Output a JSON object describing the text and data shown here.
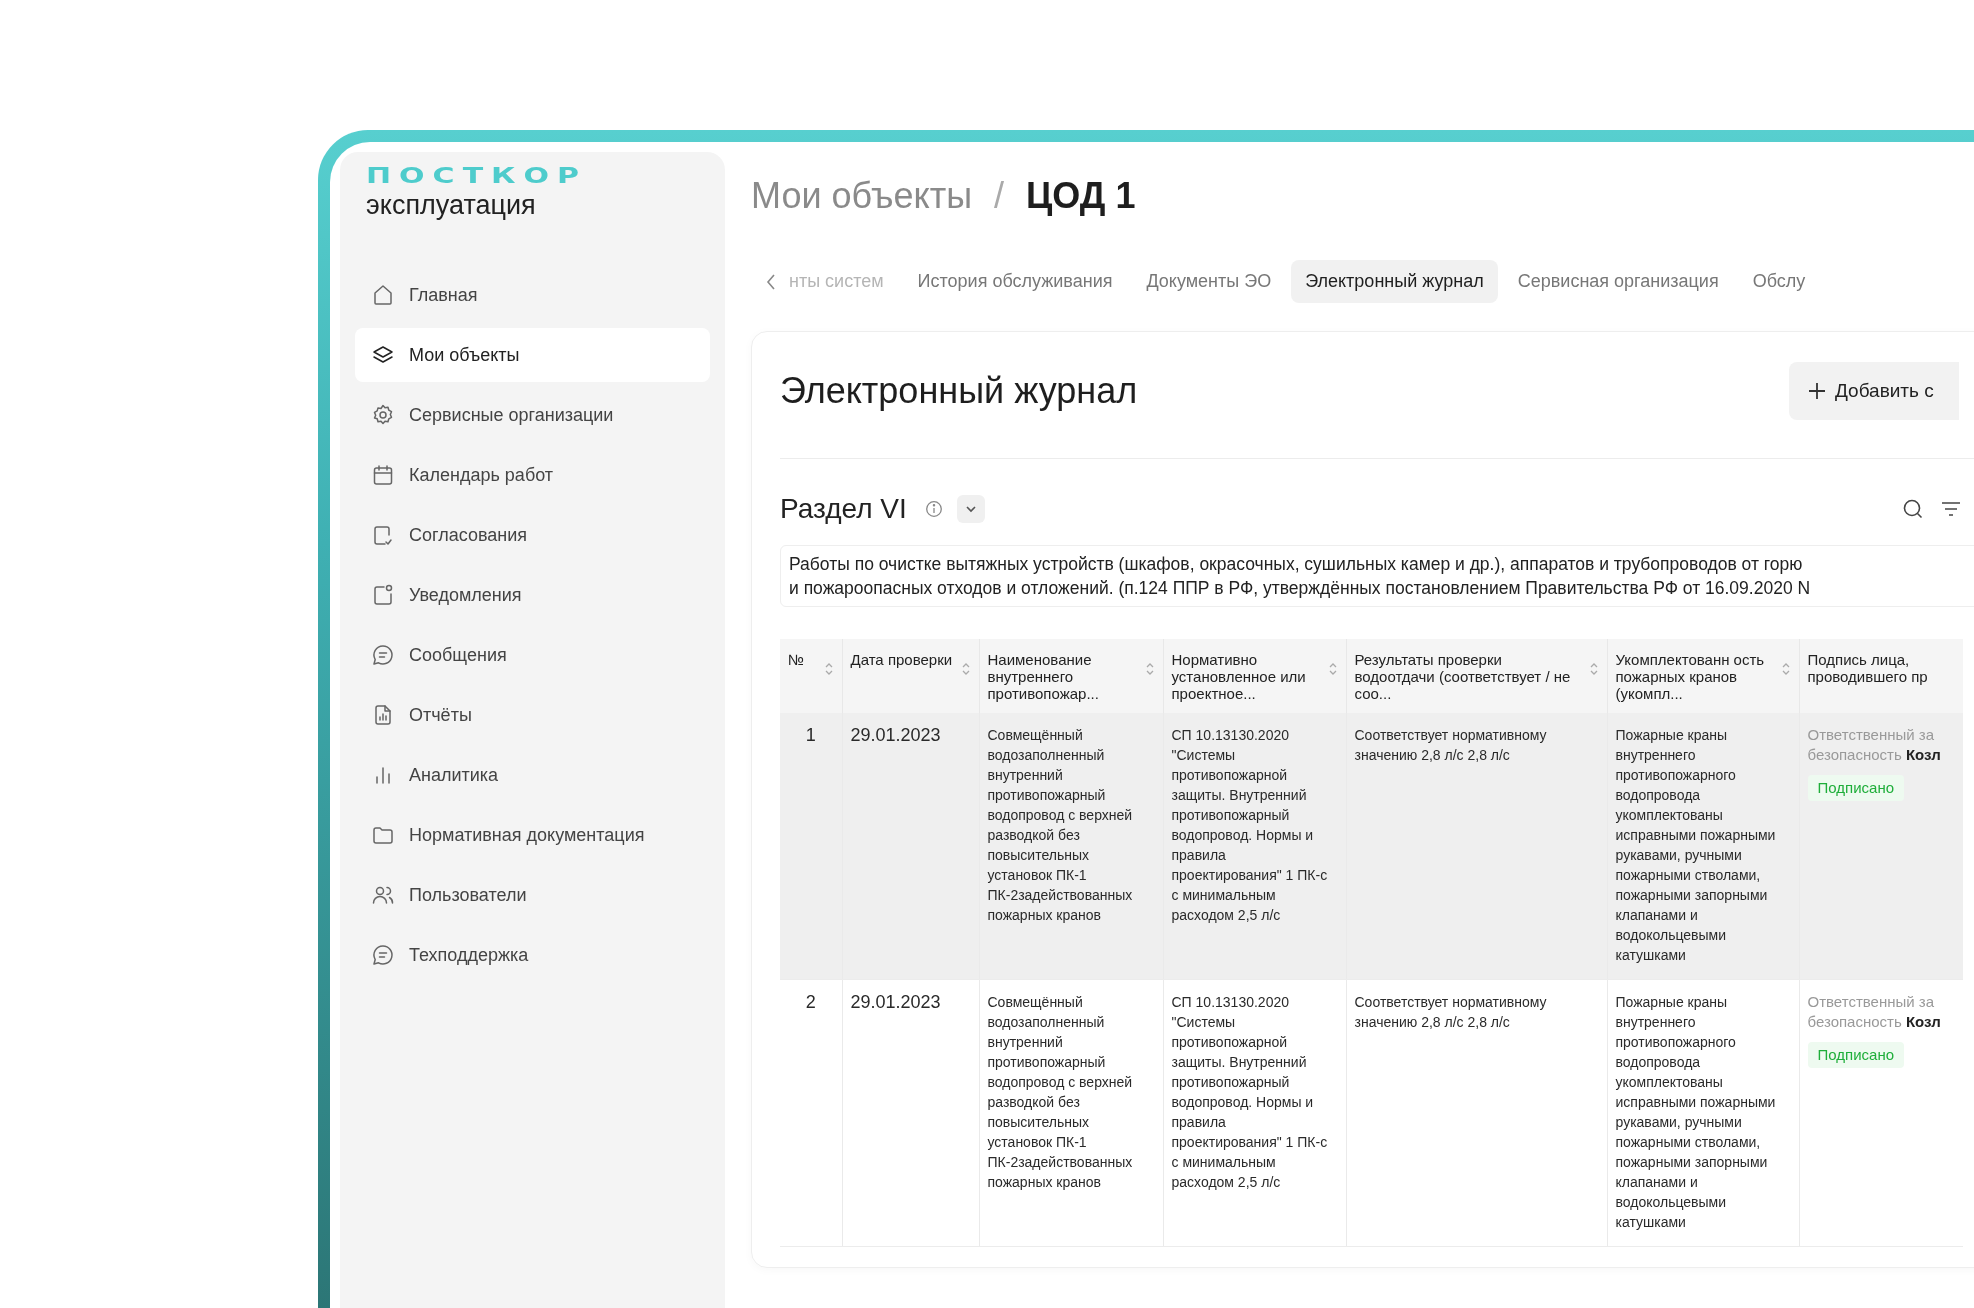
{
  "logo": {
    "brand": "ПОСТКОР",
    "subtitle": "эксплуатация"
  },
  "sidebar": {
    "items": [
      {
        "label": "Главная",
        "selected": false
      },
      {
        "label": "Мои объекты",
        "selected": true
      },
      {
        "label": "Сервисные организации",
        "selected": false
      },
      {
        "label": "Календарь работ",
        "selected": false
      },
      {
        "label": "Согласования",
        "selected": false
      },
      {
        "label": "Уведомления",
        "selected": false
      },
      {
        "label": "Сообщения",
        "selected": false
      },
      {
        "label": "Отчёты",
        "selected": false
      },
      {
        "label": "Аналитика",
        "selected": false
      },
      {
        "label": "Нормативная документация",
        "selected": false
      },
      {
        "label": "Пользователи",
        "selected": false
      },
      {
        "label": "Техподдержка",
        "selected": false
      }
    ]
  },
  "breadcrumb": {
    "items": [
      "Мои объекты",
      "ЦОД 1"
    ],
    "separator": "/"
  },
  "tabs": [
    {
      "label": "нты систем",
      "selected": false
    },
    {
      "label": "История обслуживания",
      "selected": false
    },
    {
      "label": "Документы ЭО",
      "selected": false
    },
    {
      "label": "Электронный журнал",
      "selected": true
    },
    {
      "label": "Сервисная организация",
      "selected": false
    },
    {
      "label": "Обслу",
      "selected": false
    }
  ],
  "journal": {
    "title": "Электронный журнал",
    "add_button": "Добавить с",
    "section": {
      "title": "Раздел VI",
      "description": "Работы по очистке вытяжных устройств (шкафов, окрасочных, сушильных камер и др.), аппаратов и трубопроводов от горю\nи пожароопасных отходов и отложений. (п.124 ППР в РФ, утверждённых постановлением Правительства РФ от 16.09.2020 N"
    },
    "table": {
      "columns": [
        {
          "label": "№",
          "sortable": true
        },
        {
          "label": "Дата проверки",
          "sortable": true
        },
        {
          "label": "Наименование внутреннего противопожар...",
          "sortable": true
        },
        {
          "label": "Нормативно установленное или проектное...",
          "sortable": true
        },
        {
          "label": "Результаты проверки водоотдачи (соответствует / не соо...",
          "sortable": true
        },
        {
          "label": "Укомплектованн ость пожарных кранов (укомпл...",
          "sortable": true
        },
        {
          "label": "Подпись лица, проводившего пр",
          "sortable": false
        }
      ],
      "rows": [
        {
          "selected": true,
          "number": "1",
          "date": "29.01.2023",
          "system": "Совмещённый водозаполненный внутренний противопожарный водопровод с верхней разводкой без повысительных установок ПК-1 ПК-2задействованных пожарных кранов",
          "norm": "СП 10.13130.2020 \"Системы противопожарной защиты. Внутренний противопожарный водопровод. Нормы и правила проектирования\" 1 ПК-с с минимальным расходом 2,5 л/с",
          "result": "Соответствует нормативному значению 2,8 л/с 2,8 л/с",
          "equipment": "Пожарные краны внутреннего противопожарного водопровода укомплектованы исправными пожарными рукавами, ручными пожарными стволами, пожарными запорными клапанами и водокольцевыми катушками",
          "signer": "Ответственный за безопасность **Козл**",
          "status": {
            "label": "Подписано",
            "kind": "signed"
          }
        },
        {
          "selected": false,
          "number": "2",
          "date": "29.01.2023",
          "system": "Совмещённый водозаполненный внутренний противопожарный водопровод с верхней разводкой без повысительных установок ПК-1 ПК-2задействованных пожарных кранов",
          "norm": "СП 10.13130.2020 \"Системы противопожарной защиты. Внутренний противопожарный водопровод. Нормы и правила проектирования\" 1 ПК-с с минимальным расходом 2,5 л/с",
          "result": "Соответствует нормативному значению 2,8 л/с 2,8 л/с",
          "equipment": "Пожарные краны внутреннего противопожарного водопровода укомплектованы исправными пожарными рукавами, ручными пожарными стволами, пожарными запорными клапанами и водокольцевыми катушками",
          "signer": "Ответственный за безопасность **Козл**",
          "status": {
            "label": "Подписано",
            "kind": "signed"
          }
        }
      ]
    }
  }
}
